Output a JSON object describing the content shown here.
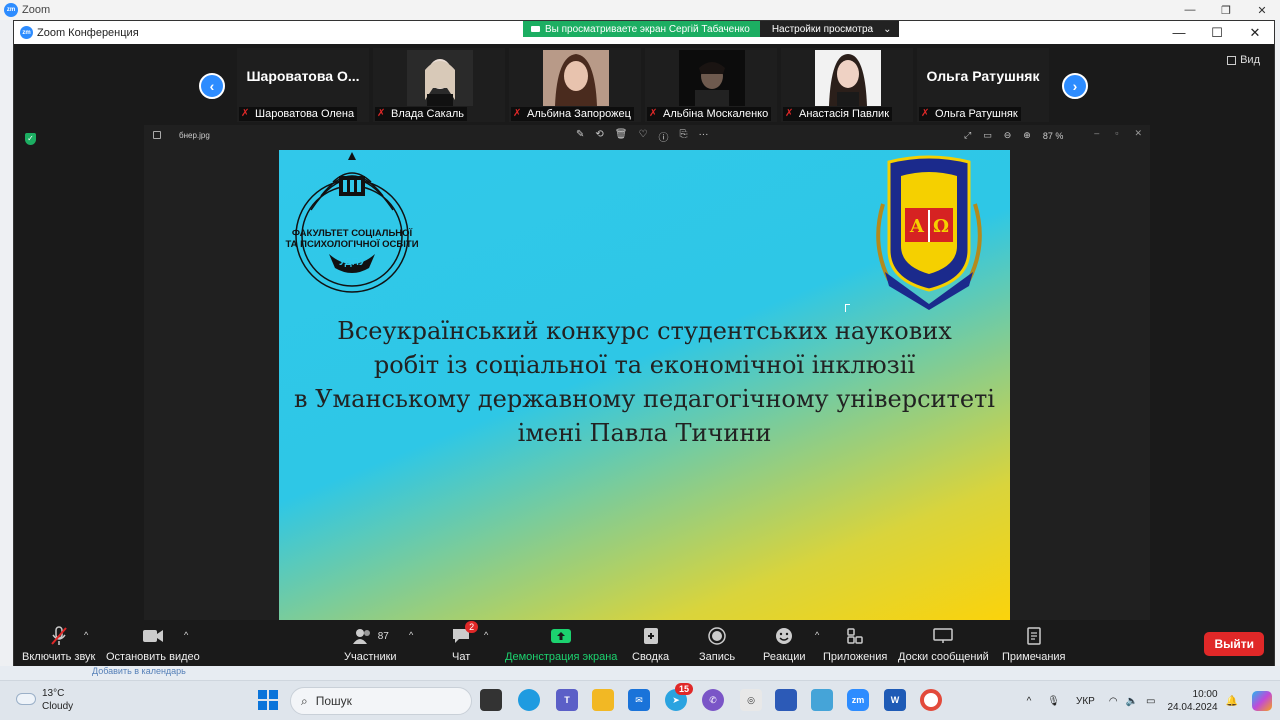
{
  "outer_window": {
    "title": "Zoom",
    "icon_text": "zm"
  },
  "zoom_window": {
    "title": "Zoom Конференция",
    "icon_text": "zm"
  },
  "share_banner": {
    "viewing_text": "Вы просматриваете экран Сергій Табаченко",
    "settings_text": "Настройки просмотра",
    "settings_caret": "⌄"
  },
  "strip": {
    "prev_glyph": "‹",
    "next_glyph": "›",
    "view_label": "Вид",
    "participants": [
      {
        "display_name": "Шароватова О...",
        "label": "Шароватова Олена",
        "has_photo": false
      },
      {
        "display_name": "",
        "label": "Влада Сакаль",
        "has_photo": true
      },
      {
        "display_name": "",
        "label": "Альбина Запорожец",
        "has_photo": true
      },
      {
        "display_name": "",
        "label": "Альбіна Москаленко",
        "has_photo": true
      },
      {
        "display_name": "",
        "label": "Анастасія Павлик",
        "has_photo": true
      },
      {
        "display_name": "Ольга Ратушняк",
        "label": "Ольга Ратушняк",
        "has_photo": false
      }
    ]
  },
  "viewer": {
    "file_name": "бнер.jpg",
    "zoom_level": "87 %",
    "tool_glyphs": [
      "✎",
      "⟲",
      "🗑",
      "♡",
      "ⓘ",
      "⎘",
      "···"
    ],
    "right_glyphs": [
      "⤢",
      "▭",
      "⊖",
      "⊕"
    ],
    "window_glyphs": [
      "–",
      "▫",
      "✕"
    ]
  },
  "slide": {
    "logo_left_text": [
      "ФАКУЛЬТЕТ СОЦІАЛЬНОЇ",
      "ТА ПСИХОЛОГІЧНОЇ ОСВІТИ",
      "УДПУ"
    ],
    "logo_right_letters": [
      "А",
      "Ω"
    ],
    "headline": [
      "Всеукраїнський конкурс студентських наукових",
      "робіт із соціальної та економічної інклюзії",
      "в Уманському державному педагогічному університеті",
      "імені Павла Тичини"
    ]
  },
  "toolbar": {
    "items": [
      {
        "label": "Включить звук"
      },
      {
        "label": "Остановить видео"
      },
      {
        "label": "Участники",
        "count": "87"
      },
      {
        "label": "Чат",
        "badge": "2"
      },
      {
        "label": "Демонстрация экрана"
      },
      {
        "label": "Сводка"
      },
      {
        "label": "Запись"
      },
      {
        "label": "Реакции"
      },
      {
        "label": "Приложения"
      },
      {
        "label": "Доски сообщений"
      },
      {
        "label": "Примечания"
      }
    ],
    "exit_label": "Выйти"
  },
  "desktop_strip_text": "Добавить в календарь",
  "taskbar": {
    "weather_temp": "13°C",
    "weather_desc": "Cloudy",
    "search_placeholder": "Пошук",
    "telegram_badge": "15",
    "language": "УКР",
    "time": "10:00",
    "date": "24.04.2024"
  },
  "colors": {
    "zoom_blue": "#2d8cff",
    "share_green": "#1cae62",
    "exit_red": "#e02828",
    "slide_top": "#2ec7e6",
    "slide_bottom": "#fbd30b"
  }
}
